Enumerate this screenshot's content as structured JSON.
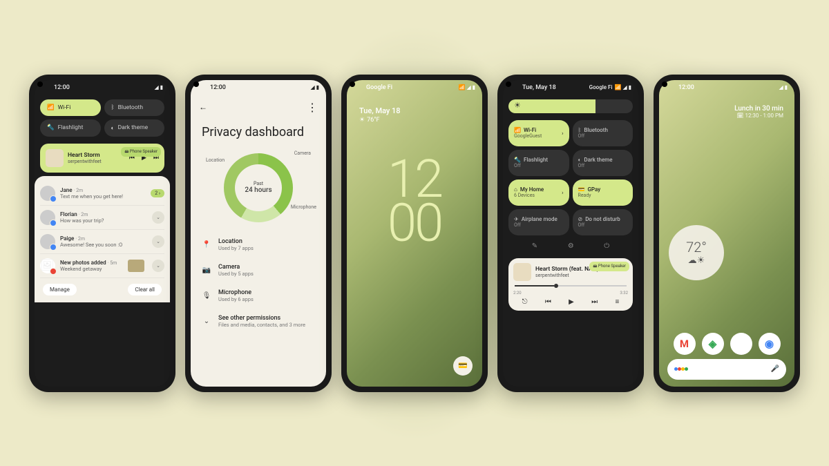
{
  "status_time": "12:00",
  "carrier": "Google Fi",
  "phone1": {
    "tiles": {
      "wifi": "Wi-Fi",
      "bluetooth": "Bluetooth",
      "flashlight": "Flashlight",
      "darktheme": "Dark theme"
    },
    "media": {
      "title": "Heart Storm",
      "artist": "serpentwithfeet",
      "badge": "🖴 Phone Speaker"
    },
    "notifs": [
      {
        "name": "Jane",
        "time": "· 2m",
        "text": "Text me when you get here!",
        "badge": "2 ›"
      },
      {
        "name": "Florian",
        "time": "· 2m",
        "text": "How was your trip?"
      },
      {
        "name": "Paige",
        "time": "· 2m",
        "text": "Awesome! See you soon :O"
      },
      {
        "name": "New photos added",
        "time": "· 5m",
        "text": "Weekend getaway"
      }
    ],
    "manage": "Manage",
    "clear": "Clear all"
  },
  "phone2": {
    "title": "Privacy dashboard",
    "donut_label": "Past",
    "donut_value": "24 hours",
    "labels": {
      "loc": "Location",
      "cam": "Camera",
      "mic": "Microphone"
    },
    "perms": [
      {
        "icon": "📍",
        "title": "Location",
        "sub": "Used by 7 apps"
      },
      {
        "icon": "📷",
        "title": "Camera",
        "sub": "Used by 5 apps"
      },
      {
        "icon": "🎙",
        "title": "Microphone",
        "sub": "Used by 6 apps"
      },
      {
        "icon": "⌄",
        "title": "See other permissions",
        "sub": "Files and media, contacts, and 3 more"
      }
    ]
  },
  "phone3": {
    "date": "Tue, May 18",
    "temp": "76°F",
    "clock_top": "12",
    "clock_bot": "00"
  },
  "phone4": {
    "date": "Tue, May 18",
    "tiles": [
      {
        "title": "Wi-Fi",
        "sub": "GoogleGuest",
        "on": true,
        "icon": "📶",
        "chev": true
      },
      {
        "title": "Bluetooth",
        "sub": "Off",
        "on": false,
        "icon": "ᛒ"
      },
      {
        "title": "Flashlight",
        "sub": "Off",
        "on": false,
        "icon": "🔦"
      },
      {
        "title": "Dark theme",
        "sub": "Off",
        "on": false,
        "icon": "◐"
      },
      {
        "title": "My Home",
        "sub": "6 Devices",
        "on": true,
        "icon": "⌂",
        "chev": true
      },
      {
        "title": "GPay",
        "sub": "Ready",
        "on": true,
        "icon": "💳"
      },
      {
        "title": "Airplane mode",
        "sub": "Off",
        "on": false,
        "icon": "✈"
      },
      {
        "title": "Do not disturb",
        "sub": "Off",
        "on": false,
        "icon": "⊘"
      }
    ],
    "media": {
      "title": "Heart Storm (feat. NAO)",
      "artist": "serpentwithfeet",
      "badge": "🖴 Phone Speaker",
      "t0": "2:20",
      "t1": "3:32"
    }
  },
  "phone5": {
    "lunch": "Lunch in 30 min",
    "lunch_time": "🗓 12:30 - 1:00 PM",
    "temp": "72°"
  }
}
